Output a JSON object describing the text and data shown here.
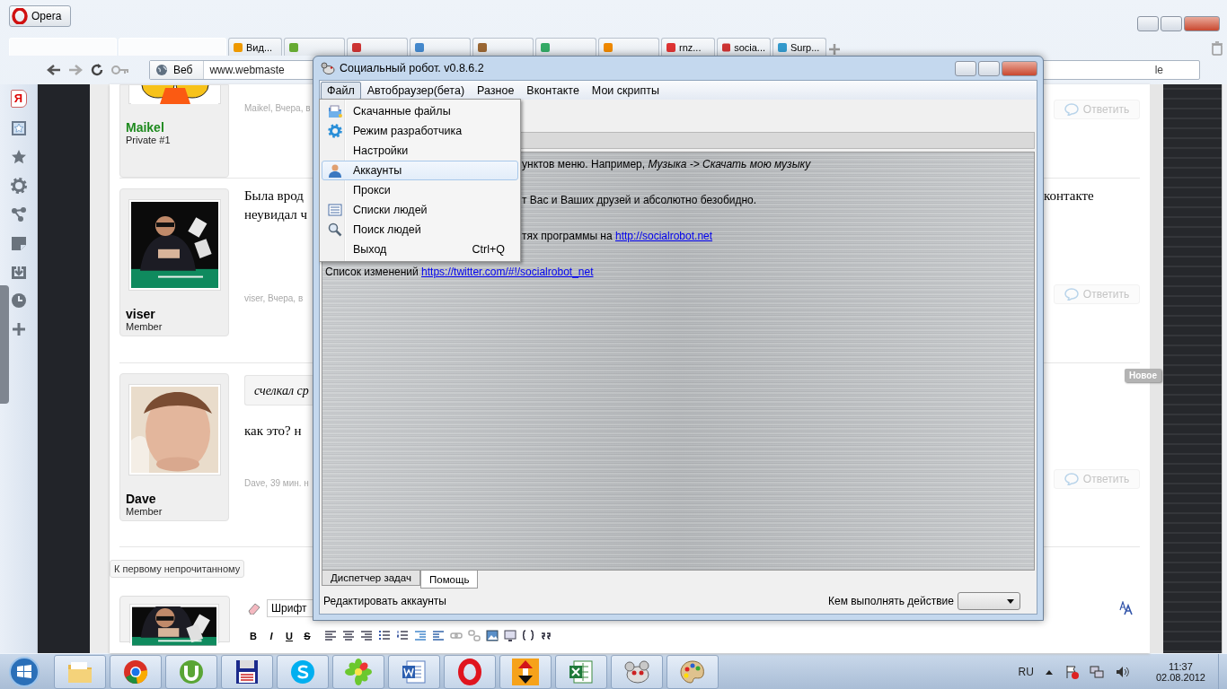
{
  "browser": {
    "app_button": "Opera",
    "tabs": [
      {
        "kind": "blurred"
      },
      {
        "kind": "blurred"
      },
      {
        "kind": "text",
        "label": "Вид..."
      },
      {
        "kind": "icon-only"
      },
      {
        "kind": "icon-only"
      },
      {
        "kind": "icon-only"
      },
      {
        "kind": "icon-only"
      },
      {
        "kind": "icon-only"
      },
      {
        "kind": "icon-only"
      },
      {
        "kind": "text",
        "label": "rnz..."
      },
      {
        "kind": "text",
        "label": "socia..."
      },
      {
        "kind": "text",
        "label": "Surp..."
      }
    ],
    "web_label": "Веб",
    "address": "www.webmaste",
    "address_tail": "le"
  },
  "sidebar": {
    "items": [
      {
        "kind": "yandex",
        "glyph": "Я"
      },
      {
        "kind": "bookmarks"
      },
      {
        "kind": "star"
      },
      {
        "kind": "settings"
      },
      {
        "kind": "share"
      },
      {
        "kind": "notes"
      },
      {
        "kind": "downloads"
      },
      {
        "kind": "history"
      },
      {
        "kind": "add"
      }
    ]
  },
  "forum": {
    "posts": [
      {
        "author": "Maikel",
        "color": "#1e8a1e",
        "rank": "Private #1",
        "meta": "Maikel, Вчера, в",
        "reply": "Ответить"
      },
      {
        "author": "viser",
        "color": "#000000",
        "rank": "Member",
        "lines": [
          {
            "left": "Была врод",
            "right": "контакте"
          },
          {
            "left": "неувидал ч"
          }
        ],
        "meta": "viser, Вчера, в",
        "reply": "Ответить"
      },
      {
        "author": "Dave",
        "color": "#000000",
        "rank": "Member",
        "quote": "счелкал ср",
        "lines": [
          {
            "left": "как это? н"
          }
        ],
        "meta": "Dave, 39 мин. н",
        "reply": "Ответить"
      }
    ],
    "new_badge": "Новое",
    "first_unread": "К первому непрочитанному",
    "editor": {
      "font_field": "Шрифт",
      "format_buttons": [
        "B",
        "I",
        "U",
        "S"
      ]
    }
  },
  "app": {
    "title": "Социальный робот. v0.8.6.2",
    "menu": [
      {
        "label": "Файл",
        "selected": true
      },
      {
        "label": "Автобраузер(бета)",
        "selected": false
      },
      {
        "label": "Разное",
        "selected": false
      },
      {
        "label": "Вконтакте",
        "selected": false
      },
      {
        "label": "Мои скрипты",
        "selected": false
      }
    ],
    "file_menu": [
      {
        "label": "Скачанные файлы",
        "kind": "folder",
        "selected": false
      },
      {
        "label": "Режим разработчика",
        "kind": "gear",
        "selected": false
      },
      {
        "label": "Настройки",
        "selected": false
      },
      {
        "label": "Аккаунты",
        "kind": "user",
        "selected": true
      },
      {
        "label": "Прокси",
        "selected": false
      },
      {
        "label": "Списки людей",
        "kind": "list",
        "selected": false
      },
      {
        "label": "Поиск людей",
        "kind": "search",
        "selected": false
      },
      {
        "label": "Выход",
        "shortcut": "Ctrl+Q",
        "selected": false
      }
    ],
    "content": [
      {
        "kind": "clipped",
        "text": "унктов меню. Например, *Музыка -> Скачать мою музыку*"
      },
      {
        "kind": "clipped",
        "text": "т Вас и Ваших друзей и абсолютно безобидно."
      },
      {
        "kind": "clipped",
        "text": "тях программы на ",
        "link": "http://socialrobot.net"
      },
      {
        "kind": "full",
        "text": "Список изменений ",
        "link": "https://twitter.com/#!/socialrobot_net"
      }
    ],
    "bottom_tabs": [
      {
        "label": "Диспетчер задач",
        "selected": false
      },
      {
        "label": "Помощь",
        "selected": true
      }
    ],
    "status": "Редактировать аккаунты",
    "performer_label": "Кем выполнять действие"
  },
  "taskbar": {
    "apps": [
      {
        "kind": "folder"
      },
      {
        "kind": "chrome"
      },
      {
        "kind": "utorrent"
      },
      {
        "kind": "floppy"
      },
      {
        "kind": "skype"
      },
      {
        "kind": "icq"
      },
      {
        "kind": "word"
      },
      {
        "kind": "opera"
      },
      {
        "kind": "arrow"
      },
      {
        "kind": "excel"
      },
      {
        "kind": "robot"
      },
      {
        "kind": "paint"
      }
    ],
    "language": "RU",
    "time": "11:37",
    "date": "02.08.2012"
  }
}
